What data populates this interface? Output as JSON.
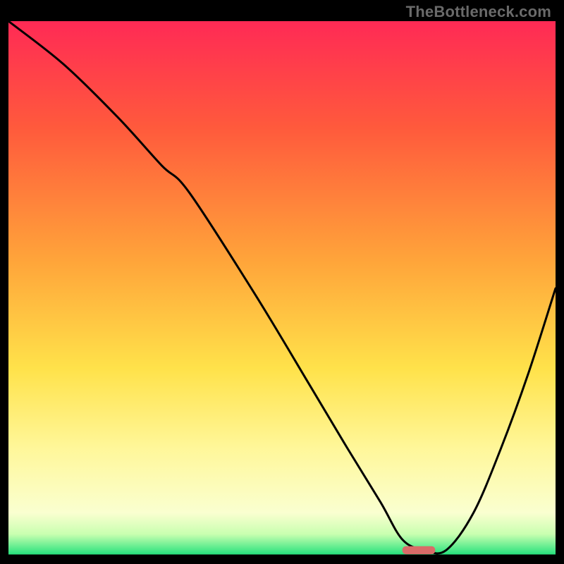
{
  "watermark": "TheBottleneck.com",
  "chart_data": {
    "type": "line",
    "title": "",
    "xlabel": "",
    "ylabel": "",
    "xlim": [
      0,
      100
    ],
    "ylim": [
      0,
      100
    ],
    "gradient_stops": [
      {
        "offset": 0,
        "color": "#ff2a55"
      },
      {
        "offset": 20,
        "color": "#ff5a3c"
      },
      {
        "offset": 45,
        "color": "#ffa53a"
      },
      {
        "offset": 65,
        "color": "#ffe24a"
      },
      {
        "offset": 80,
        "color": "#fff79a"
      },
      {
        "offset": 92,
        "color": "#faffd0"
      },
      {
        "offset": 96,
        "color": "#c9ffb0"
      },
      {
        "offset": 100,
        "color": "#1ee07a"
      }
    ],
    "series": [
      {
        "name": "bottleneck-curve",
        "x": [
          0,
          10,
          20,
          28,
          33,
          45,
          55,
          62,
          68,
          72,
          76,
          80,
          85,
          90,
          95,
          100
        ],
        "y": [
          100,
          92,
          82,
          73,
          68,
          49,
          32,
          20,
          10,
          3,
          1,
          1,
          8,
          20,
          34,
          50
        ]
      }
    ],
    "marker": {
      "x": 75,
      "y": 1,
      "width": 6,
      "height": 1.5,
      "color": "#d96b68"
    },
    "baseline_y": 0
  }
}
